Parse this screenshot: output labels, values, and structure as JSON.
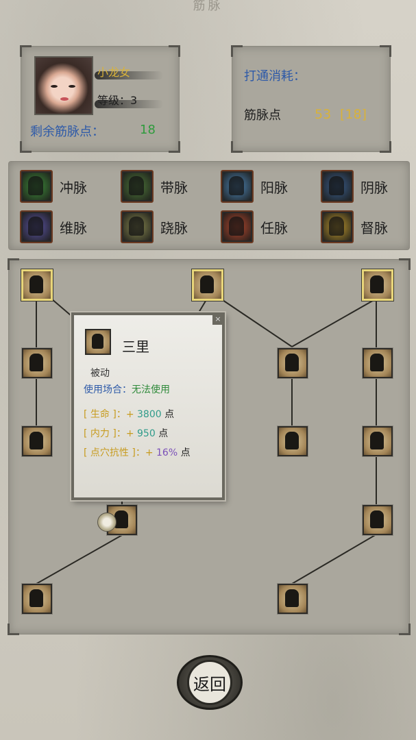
{
  "screen_title": "筋脉",
  "character": {
    "name": "小龙女",
    "level_label": "等级：",
    "level_value": "3",
    "remaining_points_label": "剩余筋脉点：",
    "remaining_points_value": "18"
  },
  "cost": {
    "title": "打通消耗：",
    "meridian_points_label": "筋脉点",
    "meridian_points_value": "53",
    "meridian_points_required": "[18]"
  },
  "meridians": [
    {
      "label": "冲脉",
      "color": "#3e8f3a"
    },
    {
      "label": "带脉",
      "color": "#4f7a3a"
    },
    {
      "label": "阳脉",
      "color": "#4d86b8"
    },
    {
      "label": "阴脉",
      "color": "#3a5f8f"
    },
    {
      "label": "维脉",
      "color": "#5c55a6"
    },
    {
      "label": "跷脉",
      "color": "#8a8a50"
    },
    {
      "label": "任脉",
      "color": "#b8482e"
    },
    {
      "label": "督脉",
      "color": "#c19a2e"
    }
  ],
  "tooltip": {
    "name": "三里",
    "type": "被动",
    "usage_label": "使用场合：",
    "usage_value": "无法使用",
    "stats": [
      {
        "open": "[ 生命 ]：+ ",
        "value": "3800",
        "unit": " 点"
      },
      {
        "open": "[ 内力 ]：+ ",
        "value": "950",
        "unit": " 点"
      },
      {
        "open": "[ 点穴抗性 ]：+ ",
        "value": "16%",
        "unit": " 点"
      }
    ],
    "close_icon": "×"
  },
  "back_button": "返回"
}
